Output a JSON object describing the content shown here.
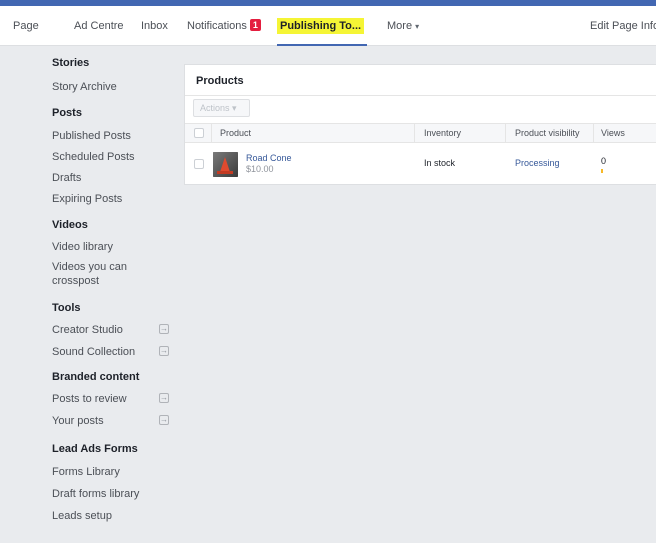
{
  "nav": {
    "items": [
      {
        "label": "Page"
      },
      {
        "label": "Ad Centre"
      },
      {
        "label": "Inbox"
      },
      {
        "label": "Notifications",
        "badge": "1"
      },
      {
        "label": "Publishing To..."
      },
      {
        "label": "More",
        "caret": "▾"
      },
      {
        "label": "Edit Page Info"
      }
    ]
  },
  "sidebar": {
    "sections": [
      {
        "title": "Stories",
        "items": [
          "Story Archive"
        ]
      },
      {
        "title": "Posts",
        "items": [
          "Published Posts",
          "Scheduled Posts",
          "Drafts",
          "Expiring Posts"
        ]
      },
      {
        "title": "Videos",
        "items": [
          "Video library",
          "Videos you can crosspost"
        ]
      },
      {
        "title": "Tools",
        "items": [
          "Creator Studio",
          "Sound Collection"
        ]
      },
      {
        "title": "Branded content",
        "items": [
          "Posts to review",
          "Your posts"
        ]
      },
      {
        "title": "Lead Ads Forms",
        "items": [
          "Forms Library",
          "Draft forms library",
          "Leads setup"
        ]
      }
    ],
    "external_icon": "external-link-icon"
  },
  "products": {
    "title": "Products",
    "actions_label": "Actions",
    "actions_caret": "▾",
    "columns": [
      "Product",
      "Inventory",
      "Product visibility",
      "Views"
    ],
    "rows": [
      {
        "name": "Road Cone",
        "price": "$10.00",
        "inventory": "In stock",
        "visibility": "Processing",
        "views": "0"
      }
    ]
  },
  "colors": {
    "brand": "#4267b2",
    "highlight": "#f5f535",
    "badge": "#e41e3f",
    "link": "#365899"
  }
}
